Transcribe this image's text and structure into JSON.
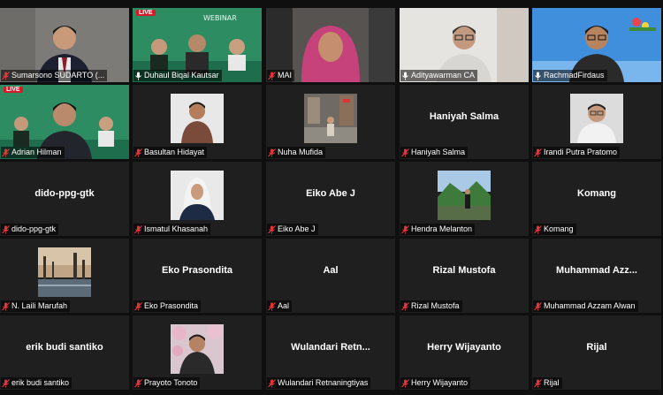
{
  "participants": [
    {
      "name": "Sumarsono SUDARTO (...",
      "display": "",
      "video": "person-grey",
      "mic": "muted"
    },
    {
      "name": "Duhaul Biqal Kautsar",
      "display": "",
      "video": "webinar-banner",
      "mic": "unmuted"
    },
    {
      "name": "MAI",
      "display": "",
      "video": "person-hijab",
      "mic": "muted"
    },
    {
      "name": "Adityawarman CA",
      "display": "",
      "video": "person-glasses",
      "mic": "unmuted"
    },
    {
      "name": "RachmadFirdaus",
      "display": "",
      "video": "person-sky",
      "mic": "unmuted",
      "active": true
    },
    {
      "name": "Adrian Hilman",
      "display": "",
      "video": "webinar-person",
      "mic": "muted"
    },
    {
      "name": "Basultan Hidayat",
      "display": "",
      "video": "photo-man",
      "mic": "muted"
    },
    {
      "name": "Nuha Mufida",
      "display": "",
      "video": "photo-street",
      "mic": "muted"
    },
    {
      "name": "Haniyah Salma",
      "display": "Haniyah Salma",
      "video": "none",
      "mic": "muted"
    },
    {
      "name": "Irandi Putra Pratomo",
      "display": "",
      "video": "photo-man-glasses",
      "mic": "muted"
    },
    {
      "name": "dido-ppg-gtk",
      "display": "dido-ppg-gtk",
      "video": "none",
      "mic": "muted"
    },
    {
      "name": "Ismatul Khasanah",
      "display": "",
      "video": "photo-hijab",
      "mic": "muted"
    },
    {
      "name": "Eiko Abe J",
      "display": "Eiko Abe J",
      "video": "none",
      "mic": "muted"
    },
    {
      "name": "Hendra Melanton",
      "display": "",
      "video": "photo-landscape",
      "mic": "muted"
    },
    {
      "name": "Komang",
      "display": "Komang",
      "video": "none",
      "mic": "muted"
    },
    {
      "name": "N. Laili Marufah",
      "display": "",
      "video": "photo-city",
      "mic": "muted"
    },
    {
      "name": "Eko Prasondita",
      "display": "Eko Prasondita",
      "video": "none",
      "mic": "muted"
    },
    {
      "name": "Aal",
      "display": "Aal",
      "video": "none",
      "mic": "muted"
    },
    {
      "name": "Rizal Mustofa",
      "display": "Rizal Mustofa",
      "video": "none",
      "mic": "muted"
    },
    {
      "name": "Muhammad Azzam Alwan",
      "display": "Muhammad Azz...",
      "video": "none",
      "mic": "muted"
    },
    {
      "name": "erik budi santiko",
      "display": "erik budi santiko",
      "video": "none",
      "mic": "muted"
    },
    {
      "name": "Prayoto Tonoto",
      "display": "",
      "video": "photo-blossom",
      "mic": "muted"
    },
    {
      "name": "Wulandari Retnaningtiyas",
      "display": "Wulandari Retn...",
      "video": "none",
      "mic": "muted"
    },
    {
      "name": "Herry Wijayanto",
      "display": "Herry Wijayanto",
      "video": "none",
      "mic": "muted"
    },
    {
      "name": "Rijal",
      "display": "Rijal",
      "video": "none",
      "mic": "muted"
    }
  ],
  "live_badge": "LIVE",
  "colors": {
    "active_border": "#c7d33a",
    "muted_icon": "#e3343b",
    "tile_bg": "#1f1f1f"
  }
}
